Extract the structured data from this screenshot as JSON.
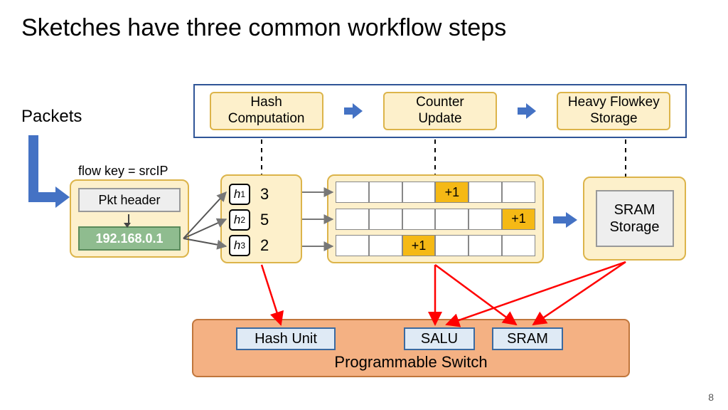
{
  "title": "Sketches have three common workflow steps",
  "labels": {
    "packets": "Packets",
    "flowkey": "flow key = srcIP"
  },
  "workflow": {
    "steps": [
      "Hash\nComputation",
      "Counter\nUpdate",
      "Heavy Flowkey\nStorage"
    ]
  },
  "packet": {
    "header": "Pkt header",
    "ip": "192.168.0.1"
  },
  "hash": {
    "rows": [
      {
        "name": "h",
        "sub": "1",
        "value": "3"
      },
      {
        "name": "h",
        "sub": "2",
        "value": "5"
      },
      {
        "name": "h",
        "sub": "3",
        "value": "2"
      }
    ]
  },
  "counter": {
    "cols": 6,
    "inc_label": "+1",
    "highlight_index": {
      "r0": 3,
      "r1": 5,
      "r2": 2
    }
  },
  "sram": "SRAM\nStorage",
  "switch": {
    "title": "Programmable Switch",
    "units": {
      "hash": "Hash Unit",
      "salu": "SALU",
      "sram": "SRAM"
    }
  },
  "page": "8"
}
